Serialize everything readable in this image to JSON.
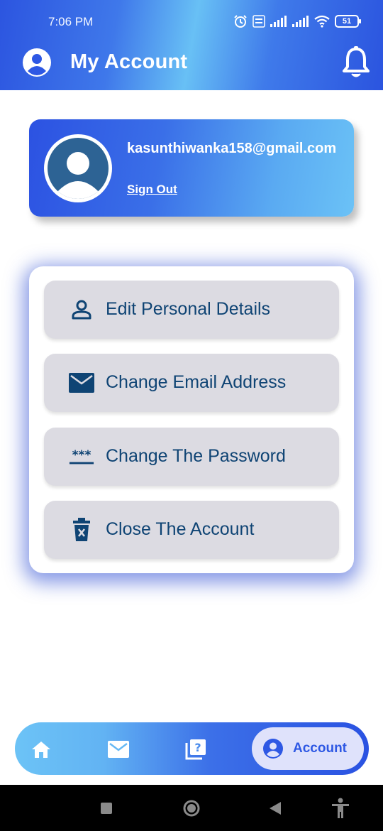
{
  "status_bar": {
    "time": "7:06 PM",
    "battery": "51"
  },
  "header": {
    "title": "My Account"
  },
  "profile": {
    "email": "kasunthiwanka158@gmail.com",
    "sign_out_label": "Sign Out"
  },
  "menu": {
    "items": [
      {
        "label": "Edit Personal Details",
        "icon": "person-outline-icon"
      },
      {
        "label": "Change Email Address",
        "icon": "envelope-icon"
      },
      {
        "label": "Change The Password",
        "icon": "password-icon"
      },
      {
        "label": "Close The Account",
        "icon": "trash-x-icon"
      }
    ]
  },
  "bottom_nav": {
    "items": [
      {
        "icon": "home-icon"
      },
      {
        "icon": "mail-icon"
      },
      {
        "icon": "help-book-icon"
      },
      {
        "icon": "account-icon",
        "label": "Account",
        "active": true
      }
    ]
  },
  "colors": {
    "primary": "#2c55e0",
    "accent_light": "#6cc3f6",
    "menu_text": "#0f4474",
    "menu_bg": "#dcdbe2"
  }
}
